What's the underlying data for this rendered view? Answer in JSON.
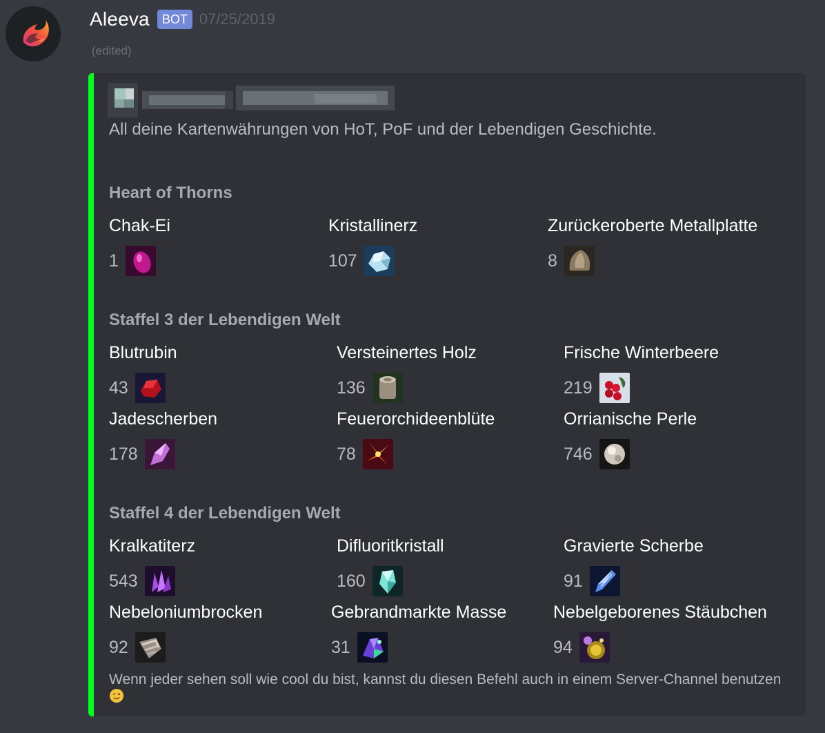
{
  "author": {
    "name": "Aleeva",
    "bot_tag": "BOT",
    "timestamp": "07/25/2019",
    "edited": "(edited)"
  },
  "embed": {
    "accent_color": "#00ff1e",
    "description": "All deine Kartenwährungen von HoT, PoF und der Lebendigen Geschichte.",
    "sections": [
      {
        "title": "Heart of Thorns",
        "fields": [
          {
            "name": "Chak-Ei",
            "value": "1",
            "icon": "chak-egg-icon"
          },
          {
            "name": "Kristallinerz",
            "value": "107",
            "icon": "crystalline-ore-icon"
          },
          {
            "name": "Zurückeroberte Metallplatte",
            "value": "8",
            "icon": "reclaimed-metal-plate-icon"
          }
        ]
      },
      {
        "title": "Staffel 3 der Lebendigen Welt",
        "fields": [
          {
            "name": "Blutrubin",
            "value": "43",
            "icon": "blood-ruby-icon"
          },
          {
            "name": "Versteinertes Holz",
            "value": "136",
            "icon": "petrified-wood-icon"
          },
          {
            "name": "Frische Winterbeere",
            "value": "219",
            "icon": "winterberry-icon"
          },
          {
            "name": "Jadescherben",
            "value": "178",
            "icon": "jade-shard-icon"
          },
          {
            "name": "Feuerorchideenblüte",
            "value": "78",
            "icon": "fire-orchid-icon"
          },
          {
            "name": "Orrianische Perle",
            "value": "746",
            "icon": "orrian-pearl-icon"
          }
        ]
      },
      {
        "title": "Staffel 4 der Lebendigen Welt",
        "fields": [
          {
            "name": "Kralkatiterz",
            "value": "543",
            "icon": "kralkatite-ore-icon"
          },
          {
            "name": "Difluoritkristall",
            "value": "160",
            "icon": "difluorite-crystal-icon"
          },
          {
            "name": "Gravierte Scherbe",
            "value": "91",
            "icon": "inscribed-shard-icon"
          },
          {
            "name": "Nebeloniumbrocken",
            "value": "92",
            "icon": "mistonium-icon"
          },
          {
            "name": "Gebrandmarkte Masse",
            "value": "31",
            "icon": "branded-mass-icon"
          },
          {
            "name": "Nebelgeborenes Stäubchen",
            "value": "94",
            "icon": "mistborn-mote-icon"
          }
        ]
      }
    ],
    "footer": "Wenn jeder sehen soll wie cool du bist, kannst du diesen Befehl auch in einem Server-Channel benutzen",
    "footer_emoji": "winking-face-icon"
  }
}
